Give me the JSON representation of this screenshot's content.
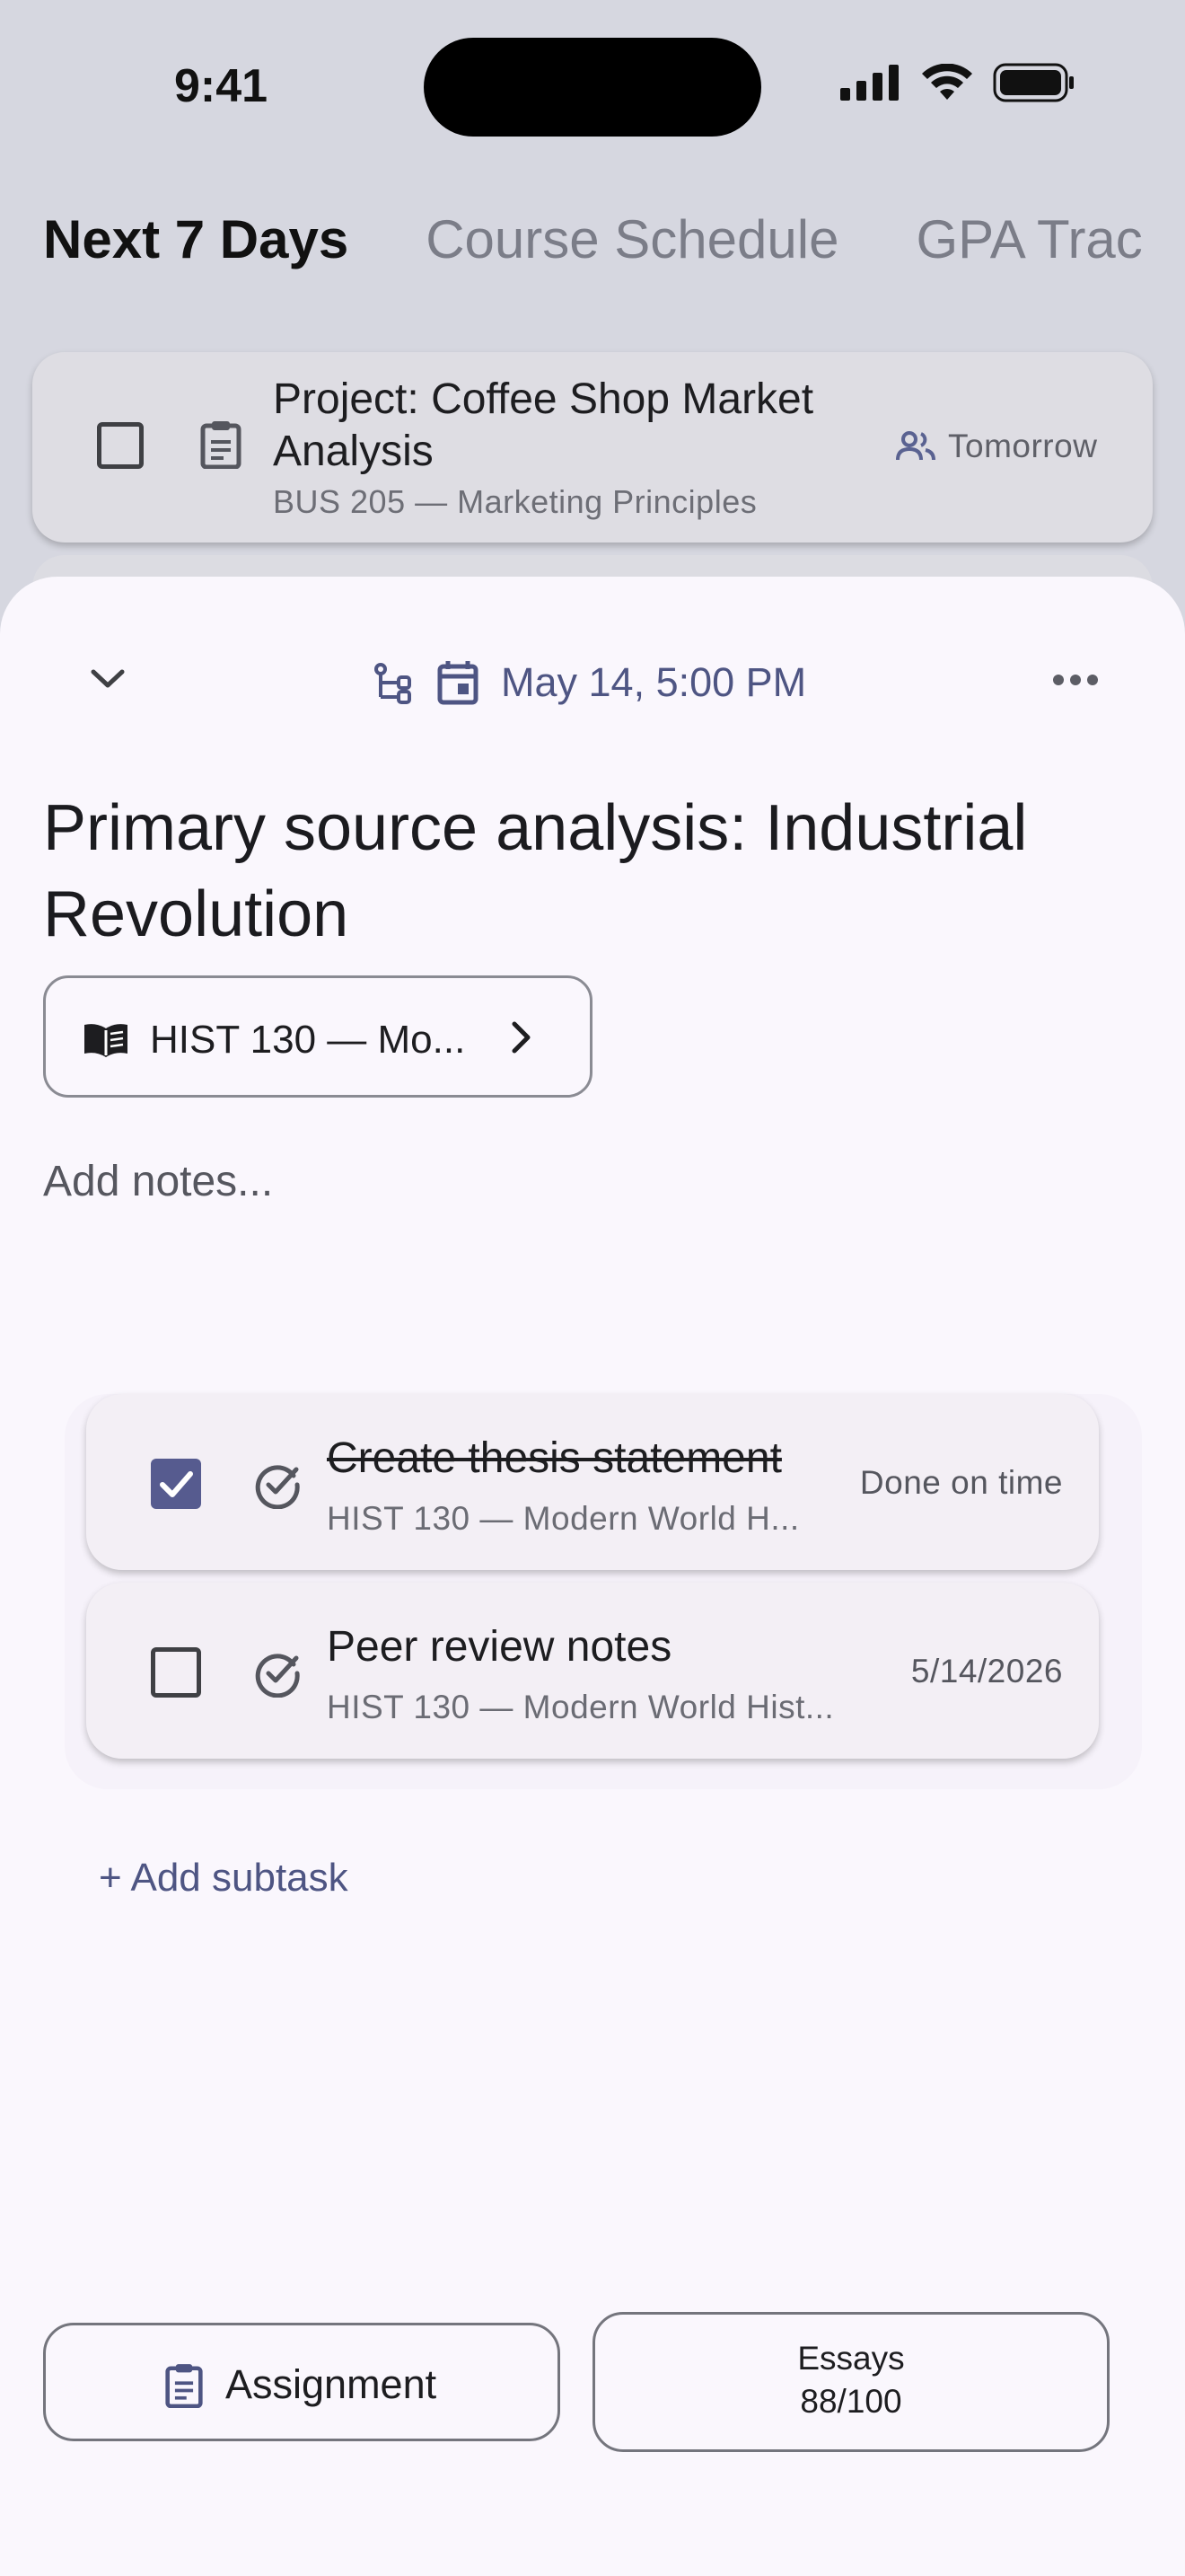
{
  "status_bar": {
    "time": "9:41"
  },
  "tabs": [
    {
      "label": "Next 7 Days"
    },
    {
      "label": "Course Schedule"
    },
    {
      "label": "GPA Trac"
    }
  ],
  "background_task": {
    "title": "Project: Coffee Shop Market Analysis",
    "course": "BUS 205 — Marketing Principles",
    "due": "Tomorrow",
    "checked": false
  },
  "sheet": {
    "due_date": "May 14, 5:00 PM",
    "title": "Primary source analysis: Industrial Revolution",
    "course_chip": "HIST 130 — Mo...",
    "notes_placeholder": "Add notes...",
    "subtasks": [
      {
        "title": "Create thesis statement",
        "course": "HIST 130 — Modern World H...",
        "status": "Done on time",
        "checked": true
      },
      {
        "title": "Peer review notes",
        "course": "HIST 130 — Modern World Hist...",
        "status": "5/14/2026",
        "checked": false
      }
    ],
    "add_subtask": "+ Add subtask",
    "type_button": "Assignment",
    "grade_button": {
      "line1": "Essays",
      "line2": "88/100"
    }
  },
  "colors": {
    "accent": "#4e5583",
    "checkbox_on": "#565b8f",
    "sheet_bg": "#faf7fd",
    "page_bg": "#d6d7e0"
  }
}
